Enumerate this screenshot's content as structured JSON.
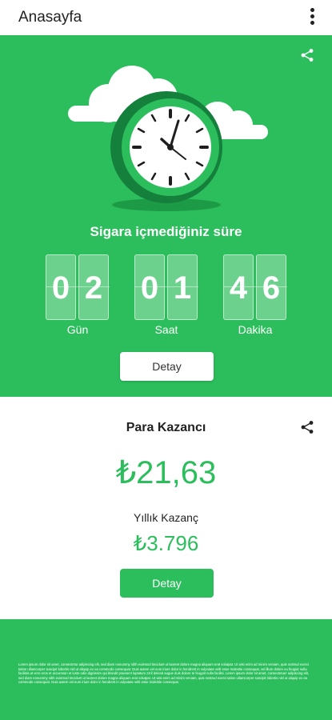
{
  "appbar": {
    "title": "Anasayfa",
    "menu_icon": "more-vert-icon"
  },
  "hero": {
    "background": "#2cbe5c",
    "share_icon": "share-icon",
    "illustration": "clock-with-clouds",
    "headline": "Sigara içmediğiniz süre",
    "counters": [
      {
        "d1": "0",
        "d2": "2",
        "label": "Gün"
      },
      {
        "d1": "0",
        "d2": "1",
        "label": "Saat"
      },
      {
        "d1": "4",
        "d2": "6",
        "label": "Dakika"
      }
    ],
    "detail_button": "Detay"
  },
  "money": {
    "title": "Para Kazancı",
    "share_icon": "share-icon",
    "amount": "₺21,63",
    "yearly_label": "Yıllık Kazanç",
    "yearly_amount": "₺3.796",
    "detail_button": "Detay",
    "accent": "#2cbe5c"
  },
  "footer": {
    "fine_print": "Lorem ipsum dolor sit amet, consectetur adipiscing elit, sed diam nonummy nibh euismod tincidunt ut laoreet dolore magna aliquam erat volutpat. Ut wisi enim ad minim veniam, quis nostrud exerci tation ullamcorper suscipit lobortis nisl ut aliquip ex ea commodo consequat. Duis autem vel eum iriure dolor in hendrerit in vulputate velit esse molestie consequat, vel illum dolore eu feugiat nulla facilisis at vero eros et accumsan et iusto odio dignissim qui blandit praesent luptatum zzril delenit augue duis dolore te feugait nulla facilisi. Lorem ipsum dolor sit amet, consectetuer adipiscing elit, sed diam nonummy nibh euismod tincidunt ut laoreet dolore magna aliquam erat volutpat. Ut wisi enim ad minim veniam, quis nostrud exerci tation ullamcorper suscipit lobortis nisl ut aliquip ex ea commodo consequat. Duis autem vel eum iriure dolor in hendrerit in vulputate velit esse molestie consequat."
  }
}
